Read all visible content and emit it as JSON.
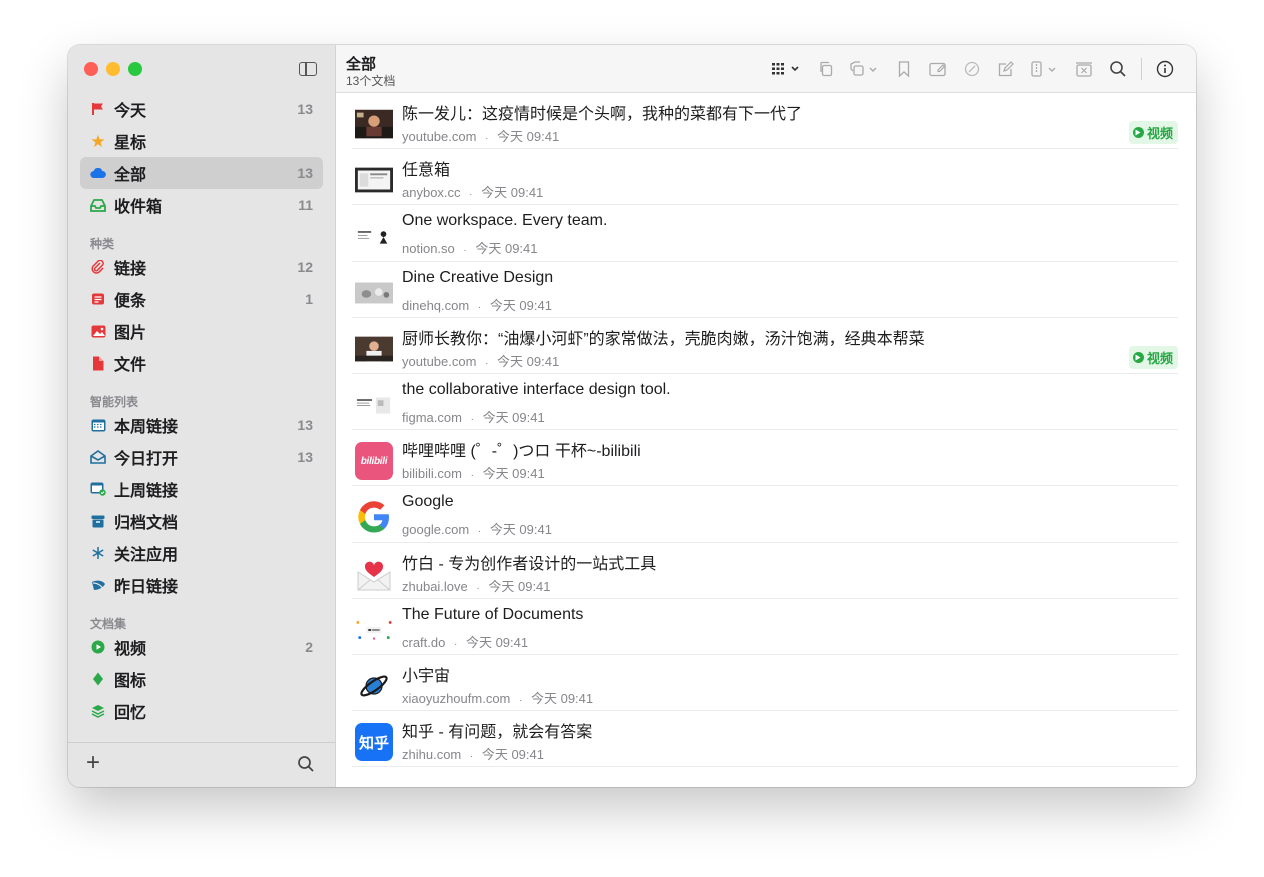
{
  "sidebar": {
    "items_top": [
      {
        "label": "今天",
        "count": "13",
        "icon": "flag-icon",
        "color": "#e5383b"
      },
      {
        "label": "星标",
        "count": "",
        "icon": "star-icon",
        "color": "#f5a623"
      },
      {
        "label": "全部",
        "count": "13",
        "icon": "cloud-icon",
        "color": "#1a73e8"
      },
      {
        "label": "收件箱",
        "count": "11",
        "icon": "inbox-icon",
        "color": "#2aa84a"
      }
    ],
    "section_kinds": "种类",
    "items_kinds": [
      {
        "label": "链接",
        "count": "12",
        "icon": "paperclip-icon",
        "color": "#e5383b"
      },
      {
        "label": "便条",
        "count": "1",
        "icon": "note-icon",
        "color": "#e5383b"
      },
      {
        "label": "图片",
        "count": "",
        "icon": "image-icon",
        "color": "#e5383b"
      },
      {
        "label": "文件",
        "count": "",
        "icon": "file-icon",
        "color": "#e5383b"
      }
    ],
    "section_smart": "智能列表",
    "items_smart": [
      {
        "label": "本周链接",
        "count": "13",
        "icon": "calendar-icon",
        "color": "#1f6f9f"
      },
      {
        "label": "今日打开",
        "count": "13",
        "icon": "opened-mail-icon",
        "color": "#1f6f9f"
      },
      {
        "label": "上周链接",
        "count": "",
        "icon": "calendar-check-icon",
        "color": "#1f6f9f"
      },
      {
        "label": "归档文档",
        "count": "",
        "icon": "archive-icon",
        "color": "#1f6f9f"
      },
      {
        "label": "关注应用",
        "count": "",
        "icon": "asterisk-icon",
        "color": "#1f6f9f"
      },
      {
        "label": "昨日链接",
        "count": "",
        "icon": "leaf-icon",
        "color": "#1f6f9f"
      }
    ],
    "section_collections": "文档集",
    "items_collections": [
      {
        "label": "视频",
        "count": "2",
        "icon": "play-circle-icon",
        "color": "#2aa84a"
      },
      {
        "label": "图标",
        "count": "",
        "icon": "diamond-icon",
        "color": "#2aa84a"
      },
      {
        "label": "回忆",
        "count": "",
        "icon": "layers-icon",
        "color": "#2aa84a"
      }
    ],
    "footer_add": "+"
  },
  "toolbar": {
    "title": "全部",
    "subtitle": "13个文档"
  },
  "documents": [
    {
      "title": "陈一发儿：这疫情时候是个头啊，我种的菜都有下一代了",
      "domain": "youtube.com",
      "time": "今天 09:41",
      "badge": "视频",
      "thumb": "video-thumbnail"
    },
    {
      "title": "任意箱",
      "domain": "anybox.cc",
      "time": "今天 09:41",
      "badge": "",
      "thumb": "screenshot-thumbnail"
    },
    {
      "title": "One workspace. Every team.",
      "domain": "notion.so",
      "time": "今天 09:41",
      "badge": "",
      "thumb": "notion-thumbnail"
    },
    {
      "title": "Dine Creative Design",
      "domain": "dinehq.com",
      "time": "今天 09:41",
      "badge": "",
      "thumb": "dine-thumbnail"
    },
    {
      "title": "厨师长教你：“油爆小河虾”的家常做法，壳脆肉嫩，汤汁饱满，经典本帮菜",
      "domain": "youtube.com",
      "time": "今天 09:41",
      "badge": "视频",
      "thumb": "video-thumbnail"
    },
    {
      "title": "the collaborative interface design tool.",
      "domain": "figma.com",
      "time": "今天 09:41",
      "badge": "",
      "thumb": "figma-thumbnail"
    },
    {
      "title": "哔哩哔哩 (゜-゜)つロ 干杯~-bilibili",
      "domain": "bilibili.com",
      "time": "今天 09:41",
      "badge": "",
      "thumb": "bilibili-logo"
    },
    {
      "title": "Google",
      "domain": "google.com",
      "time": "今天 09:41",
      "badge": "",
      "thumb": "google-logo"
    },
    {
      "title": "竹白 - 专为创作者设计的一站式工具",
      "domain": "zhubai.love",
      "time": "今天 09:41",
      "badge": "",
      "thumb": "zhubai-logo"
    },
    {
      "title": "The Future of Documents",
      "domain": "craft.do",
      "time": "今天 09:41",
      "badge": "",
      "thumb": "craft-thumbnail"
    },
    {
      "title": "小宇宙",
      "domain": "xiaoyuzhoufm.com",
      "time": "今天 09:41",
      "badge": "",
      "thumb": "planet-logo"
    },
    {
      "title": "知乎 - 有问题，就会有答案",
      "domain": "zhihu.com",
      "time": "今天 09:41",
      "badge": "",
      "thumb": "zhihu-logo"
    }
  ],
  "meta_separator": "·",
  "bilibili_logo_text": "bilibili",
  "zhihu_logo_text": "知乎"
}
